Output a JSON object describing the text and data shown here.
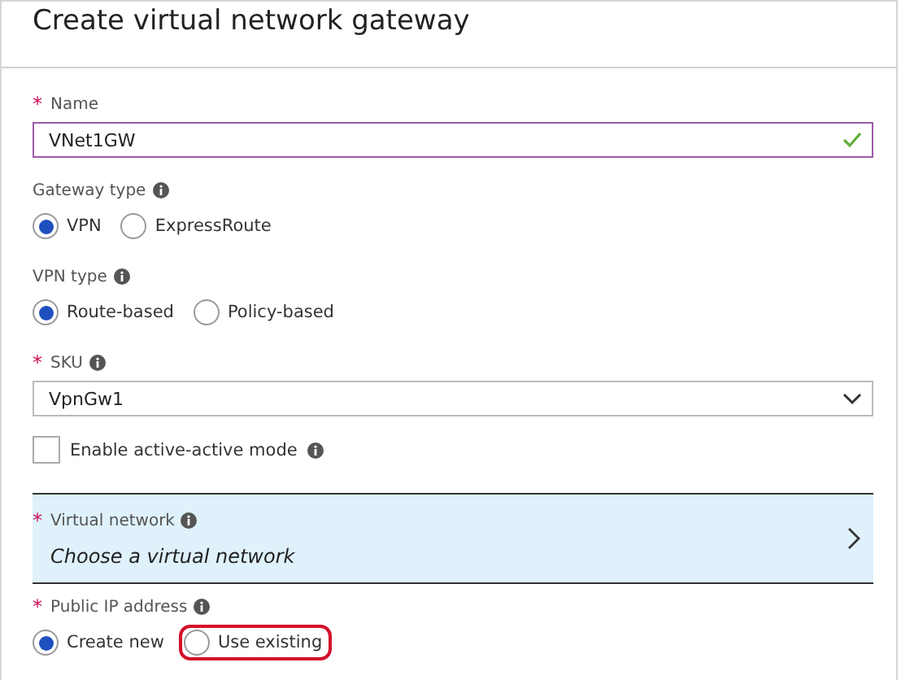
{
  "title": "Create virtual network gateway",
  "fields": [
    {
      "kind": "text",
      "asterisk": "*",
      "label": "Name",
      "value": "VNet1GW",
      "valid": true
    },
    {
      "kind": "radio",
      "label": "Gateway type",
      "info": true,
      "options": [
        {
          "label": "VPN",
          "selected": true,
          "highlighted": false
        },
        {
          "label": "ExpressRoute",
          "selected": false,
          "highlighted": false
        }
      ]
    },
    {
      "kind": "radio",
      "label": "VPN type",
      "info": true,
      "options": [
        {
          "label": "Route-based",
          "selected": true,
          "highlighted": false
        },
        {
          "label": "Policy-based",
          "selected": false,
          "highlighted": false
        }
      ]
    },
    {
      "kind": "select",
      "asterisk": "*",
      "label": "SKU",
      "info": true,
      "value": "VpnGw1"
    },
    {
      "kind": "checkbox",
      "label": "Enable active-active mode",
      "info": true,
      "checked": false
    },
    {
      "kind": "picker",
      "asterisk": "*",
      "label": "Virtual network",
      "info": true,
      "value": "Choose a virtual network"
    },
    {
      "kind": "radio",
      "asterisk": "*",
      "label": "Public IP address",
      "info": true,
      "options": [
        {
          "label": "Create new",
          "selected": true,
          "highlighted": false
        },
        {
          "label": "Use existing",
          "selected": false,
          "highlighted": true
        }
      ]
    }
  ]
}
